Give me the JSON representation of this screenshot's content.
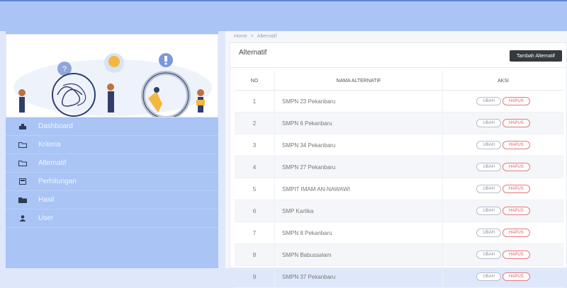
{
  "breadcrumb": {
    "home": "Home",
    "separator": ">",
    "current": "Alternatif"
  },
  "sidebar": {
    "items": [
      {
        "label": "Dashboard",
        "icon": "dashboard-icon"
      },
      {
        "label": "Kriteria",
        "icon": "folder-icon"
      },
      {
        "label": "Alternatif",
        "icon": "folder-icon"
      },
      {
        "label": "Perhitungan",
        "icon": "calculator-icon"
      },
      {
        "label": "Hasil",
        "icon": "folder-filled-icon"
      },
      {
        "label": "User",
        "icon": "user-icon"
      }
    ]
  },
  "panel": {
    "title": "Alternatif",
    "add_button": "Tambah Alternatif"
  },
  "table": {
    "headers": {
      "no": "NO",
      "name": "NAMA ALTERNATIF",
      "aksi": "AKSI"
    },
    "edit_label": "UBAH",
    "delete_label": "HAPUS",
    "rows": [
      {
        "no": "1",
        "name": "SMPN 23 Pekanbaru"
      },
      {
        "no": "2",
        "name": "SMPN 6 Pekanbaru"
      },
      {
        "no": "3",
        "name": "SMPN 34 Pekanbaru"
      },
      {
        "no": "4",
        "name": "SMPN 27 Pekanbaru"
      },
      {
        "no": "5",
        "name": "SMPIT IMAM AN-NAWAWI"
      },
      {
        "no": "6",
        "name": "SMP Kartika"
      },
      {
        "no": "7",
        "name": "SMPN 8 Pekanbaru"
      },
      {
        "no": "8",
        "name": "SMPN Babussalam"
      },
      {
        "no": "9",
        "name": "SMPN 37 Pekanbaru"
      }
    ]
  },
  "colors": {
    "topbar": "#a9c4f5",
    "sidebar": "#a9c4f5",
    "accent_dark": "#343a40",
    "delete_red": "#e15b61"
  }
}
